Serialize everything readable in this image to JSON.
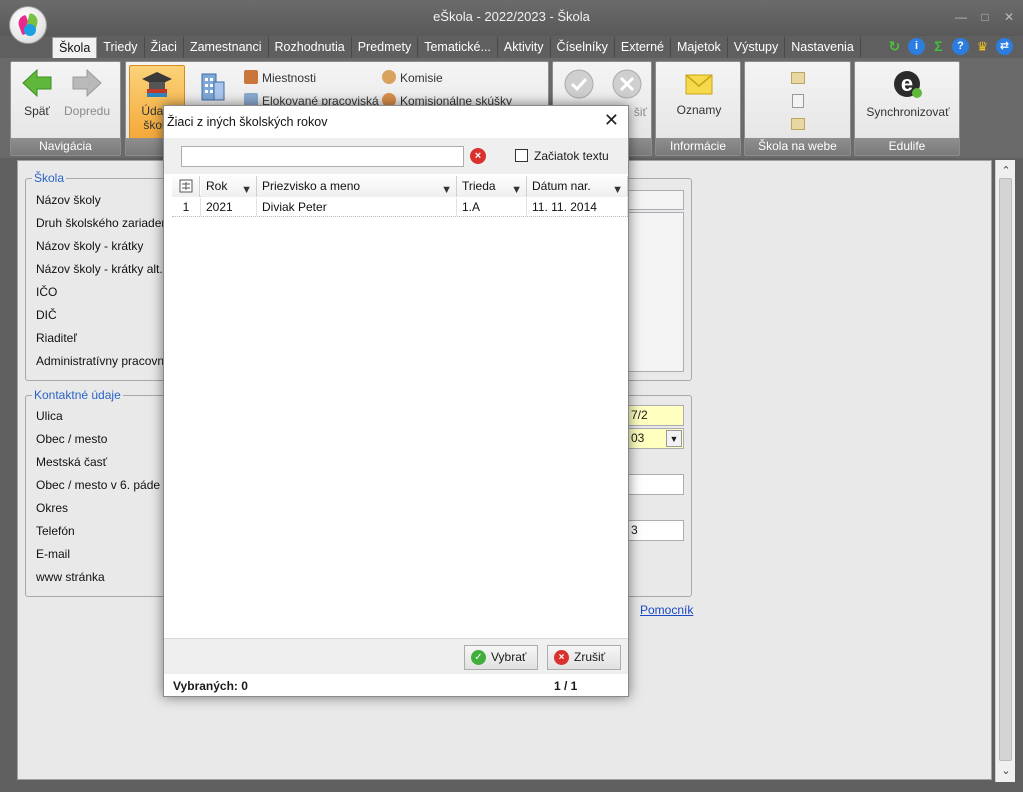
{
  "window": {
    "title": "eŠkola - 2022/2023 - Škola"
  },
  "menu": {
    "tabs": [
      "Škola",
      "Triedy",
      "Žiaci",
      "Zamestnanci",
      "Rozhodnutia",
      "Predmety",
      "Tematické...",
      "Aktivity",
      "Číselníky",
      "Externé",
      "Majetok",
      "Výstupy",
      "Nastavenia"
    ]
  },
  "ribbon": {
    "nav_back": "Späť",
    "nav_forward": "Dopredu",
    "nav_caption": "Navigácia",
    "school_data_line1": "Údaje",
    "school_data_line2": "školy",
    "rooms": "Miestnosti",
    "detached": "Elokované pracoviská",
    "commissions": "Komisie",
    "exams": "Komisionálne skúšky",
    "cancel_fragment": "šiť",
    "announcements": "Oznamy",
    "info_caption": "Informácie",
    "web_caption": "Škola na webe",
    "sync": "Synchronizovať",
    "edulife_caption": "Edulife"
  },
  "form": {
    "school_legend": "Škola",
    "school_labels": [
      "Názov školy",
      "Druh školského zariadenia",
      "Názov školy - krátky",
      "Názov školy - krátky alt.",
      "IČO",
      "DIČ",
      "Riaditeľ",
      "Administratívny pracovník"
    ],
    "contact_legend": "Kontaktné údaje",
    "contact_labels": [
      "Ulica",
      "Obec / mesto",
      "Mestská časť",
      "Obec / mesto v 6. páde",
      "Okres",
      "Telefón",
      "E-mail",
      "www stránka"
    ],
    "street_fragment": "7/2",
    "city_fragment": "03",
    "phone_fragment": "3",
    "helper_link": "Pomocník"
  },
  "dialog": {
    "title": "Žiaci z iných školských rokov",
    "search_value": "",
    "checkbox_label": "Začiatok textu",
    "columns": [
      "Rok",
      "Priezvisko a meno",
      "Trieda",
      "Dátum nar."
    ],
    "rows": [
      {
        "num": "1",
        "year": "2021",
        "name": "Diviak Peter",
        "class": "1.A",
        "birth": "11. 11. 2014"
      }
    ],
    "select_button": "Vybrať",
    "cancel_button": "Zrušiť",
    "selected_label": "Vybraných: 0",
    "pager": "1 / 1"
  }
}
